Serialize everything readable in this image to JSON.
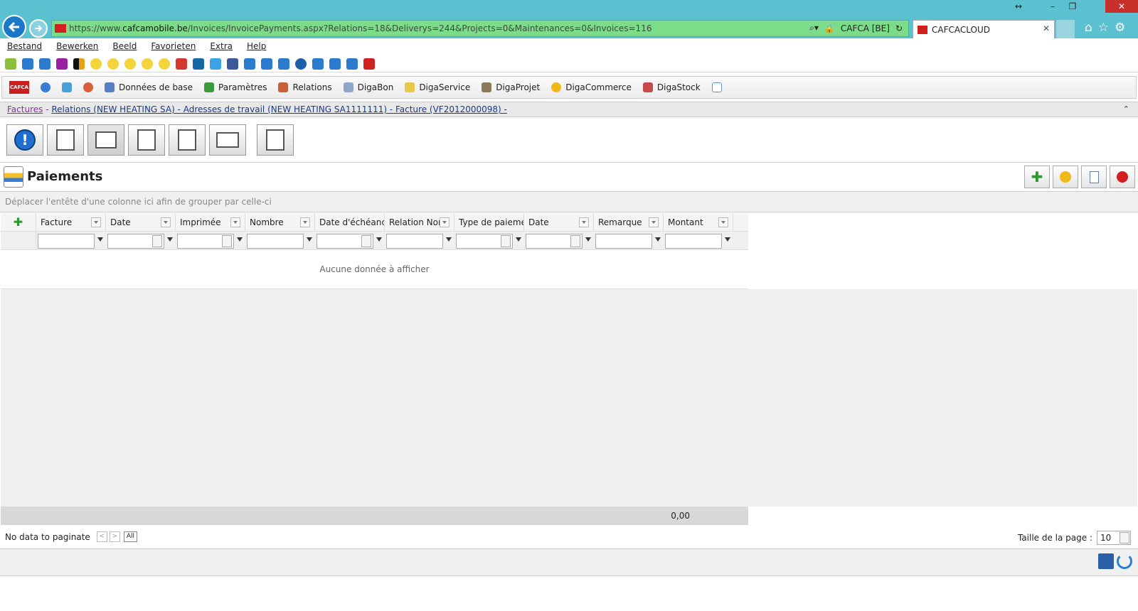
{
  "browser": {
    "window_title_icons": [
      "restore-arrows",
      "minimize",
      "maximize",
      "close"
    ],
    "url_prefix": "https://www.",
    "url_domain": "cafcamobile.be",
    "url_path": "/Invoices/InvoicePayments.aspx?Relations=18&Deliverys=244&Projects=0&Maintenances=0&Invoices=116",
    "cert_label": "CAFCA [BE]",
    "tab_title": "CAFCACLOUD",
    "accent_color": "#5bc0d0"
  },
  "menu": [
    "Bestand",
    "Bewerken",
    "Beeld",
    "Favorieten",
    "Extra",
    "Help"
  ],
  "toolbar": {
    "logo": "CAFCA",
    "items": [
      "Données de base",
      "Paramètres",
      "Relations",
      "DigaBon",
      "DigaService",
      "DigaProjet",
      "DigaCommerce",
      "DigaStock"
    ]
  },
  "breadcrumb": {
    "part1": "Factures",
    "sep": " - ",
    "part2": "Relations (NEW HEATING SA) - Adresses de travail (NEW HEATING SA1111111) - Facture (VF2012000098) -"
  },
  "panel": {
    "title": "Paiements",
    "group_hint": "Déplacer l'entête d'une colonne ici afin de grouper par celle-ci",
    "columns": [
      "Facture",
      "Date",
      "Imprimée",
      "Nombre",
      "Date d'échéance",
      "Relation Nom",
      "Type de paiement",
      "Date",
      "Remarque",
      "Montant"
    ],
    "empty_text": "Aucune donnée à afficher",
    "total": "0,00"
  },
  "pager": {
    "status": "No data to paginate",
    "prev": "<",
    "next": ">",
    "all": "All",
    "page_size_label": "Taille de la page :",
    "page_size_value": "10"
  }
}
